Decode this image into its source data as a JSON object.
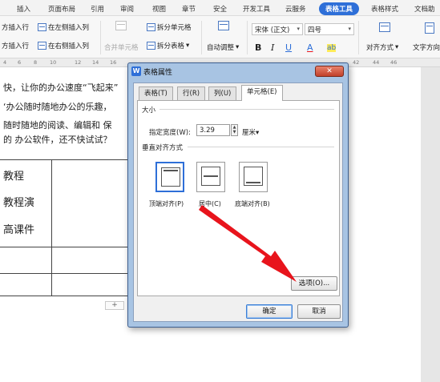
{
  "menubar": {
    "items": [
      "插入",
      "页面布局",
      "引用",
      "审阅",
      "视图",
      "章节",
      "安全",
      "开发工具",
      "云服务",
      "表格工具",
      "表格样式",
      "文档助"
    ],
    "active_index": 9,
    "active_color": "#2e6fd8"
  },
  "ribbon": {
    "insert_row_above": "方插入行",
    "insert_col_left": "在左侧插入列",
    "insert_row_below": "方插入行",
    "insert_col_right": "在右侧插入列",
    "merge_cells": "合并单元格",
    "split_cells": "拆分单元格",
    "split_table": "拆分表格",
    "split_table_arrow": "▾",
    "autofit": "自动调整",
    "autofit_arrow": "▾",
    "font_name": "宋体 (正文)",
    "font_size": "四号",
    "bold": "B",
    "italic": "I",
    "underline": "U",
    "font_color": "A",
    "highlight": "ab",
    "align": "对齐方式",
    "align_arrow": "▾",
    "text_direction": "文字方向"
  },
  "ruler": {
    "ticks": [
      "4",
      "6",
      "8",
      "10",
      "12",
      "14",
      "16",
      "42",
      "44",
      "46"
    ]
  },
  "document": {
    "lines": [
      "快，让你的办公速度“飞起来”",
      "‘办公随时随地办公的乐趣，",
      "随时随地的阅读、编辑和 保",
      "的 办公软件，还不快试试？"
    ],
    "cells": [
      "教程",
      "教程演",
      "高课件"
    ],
    "add_row_symbol": "+"
  },
  "dialog": {
    "app_logo": "W",
    "title": "表格属性",
    "close_symbol": "✕",
    "tabs": [
      "表格(T)",
      "行(R)",
      "列(U)",
      "单元格(E)"
    ],
    "active_tab_index": 3,
    "size_section": "大小",
    "width_label": "指定宽度(W):",
    "width_value": "3.29",
    "width_unit": "厘米",
    "width_unit_arrow": "▾",
    "valign_section": "垂直对齐方式",
    "valign_options": [
      "顶端对齐(P)",
      "居中(C)",
      "底端对齐(B)"
    ],
    "valign_selected_index": 0,
    "options_button": "选项(O)...",
    "ok_button": "确定",
    "cancel_button": "取消"
  },
  "annotation": {
    "arrow_color": "#e8141c"
  }
}
